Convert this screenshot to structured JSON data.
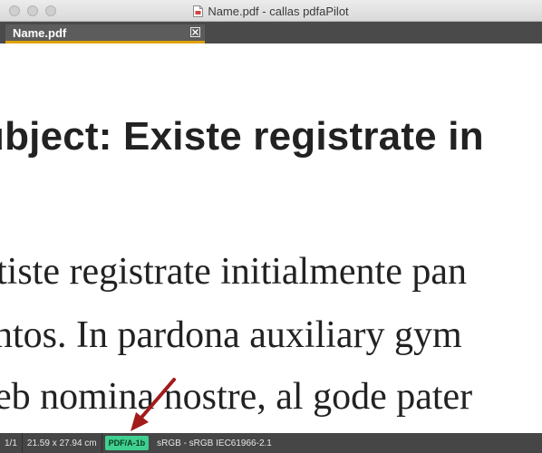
{
  "window": {
    "title": "Name.pdf - callas pdfaPilot",
    "title_icon": "pdf-document-icon"
  },
  "tab": {
    "label": "Name.pdf",
    "close_icon": "close-icon"
  },
  "document": {
    "heading": "ubject: Existe registrate in",
    "lines": [
      "tiste registrate initialmente pan",
      "ntos. In pardona auxiliary gym",
      "eb nomina nostre, al gode pater"
    ]
  },
  "statusbar": {
    "page": "1/1",
    "size": "21.59 x 27.94 cm",
    "pdfa_badge": "PDF/A-1b",
    "color_profile": "sRGB - sRGB IEC61966-2.1"
  },
  "colors": {
    "badge": "#3fd08f",
    "tab_underline": "#e0a100",
    "annotation_arrow": "#a31b1b"
  }
}
